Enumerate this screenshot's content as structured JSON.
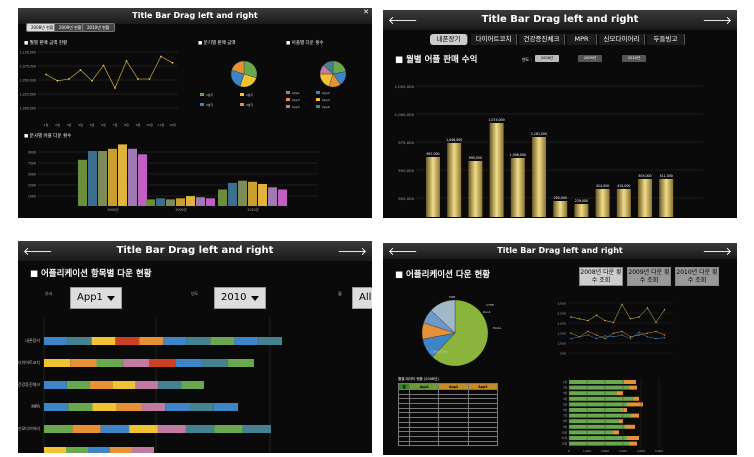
{
  "window_title": "Title Bar Drag left and right",
  "panel1": {
    "tabs": [
      "2008년 현황",
      "2009년 현황",
      "2010년 현황"
    ],
    "sections": [
      "■ 월별 판매 금액 현황",
      "■ 분기별 판매 금액",
      "■ 어플별 다운 횟수",
      "■ 분사별 어플 다운 횟수"
    ],
    "line_y_ticks": [
      "1,100,000",
      "1,075,000",
      "1,050,000",
      "1,025,000",
      "1,000,000"
    ],
    "line_x_ticks": [
      "1월",
      "2월",
      "3월",
      "4월",
      "5월",
      "6월",
      "7월",
      "8월",
      "9월",
      "10월",
      "11월",
      "12월"
    ],
    "legend_quarter": [
      "1분기",
      "2분기",
      "3분기",
      "4분기"
    ],
    "legend_app": [
      "App1",
      "App2",
      "App3",
      "App4",
      "App5",
      "App6"
    ],
    "bar_y_ticks": [
      "9000",
      "7500",
      "5000",
      "2500",
      "1000"
    ],
    "bar_groups": [
      "2008년",
      "2009년",
      "2010년"
    ]
  },
  "panel2": {
    "tabs": [
      "내폰장기",
      "다이어트코치",
      "건강증진체크",
      "MPR",
      "신모다이어리",
      "두들빙고"
    ],
    "title": "■ 월별 어플 판매 수익",
    "year_label": "연도 :",
    "years": [
      "2008년",
      "2009년",
      "2010년"
    ],
    "y_ticks": [
      "1,050,000",
      "1,000,000",
      "975,000",
      "950,000",
      "900,000"
    ],
    "bar_labels": [
      "997,000",
      "1,046,000",
      "995,000",
      "1,074,000",
      "1,008,000",
      "1,181,000",
      "250,000",
      "229,000",
      "414,000",
      "415,000",
      "505,000",
      "511,000"
    ]
  },
  "panel3": {
    "title": "■ 어플리케이션 항목별 다운 현황",
    "filter1_label": "부서",
    "filter1_value": "App1",
    "filter2_label": "년도",
    "filter2_value": "2010",
    "filter3_label": "월",
    "filter3_value": "All",
    "rows": [
      "내폰장기",
      "다이어트코치",
      "건강증진체크",
      "MPR",
      "신모다이어리"
    ]
  },
  "panel4": {
    "title": "■ 어플리케이션 다운 현황",
    "buttons": [
      "2008년 다운 횟수 조회",
      "2009년 다운 횟수 조회",
      "2010년 다운 횟수 조회"
    ],
    "pie_labels": [
      "MPR",
      "CTHE",
      "Rank",
      "Mode",
      "다이어트코치"
    ],
    "table_title": "월별 데이터 현황 (2008년)",
    "table_headers": [
      "월",
      "App1",
      "App2",
      "App3"
    ],
    "table_rows": 12,
    "line_y_ticks": [
      "3,000",
      "2,500",
      "2,000",
      "1,500",
      "1,000",
      "500"
    ],
    "hbar_rows": [
      "1월",
      "2월",
      "3월",
      "4월",
      "5월",
      "6월",
      "7월",
      "8월",
      "9월",
      "10월",
      "11월",
      "12월"
    ],
    "hbar_x_ticks": [
      "0",
      "1,000",
      "2,000",
      "3,000",
      "4,000",
      "5,000"
    ]
  }
}
